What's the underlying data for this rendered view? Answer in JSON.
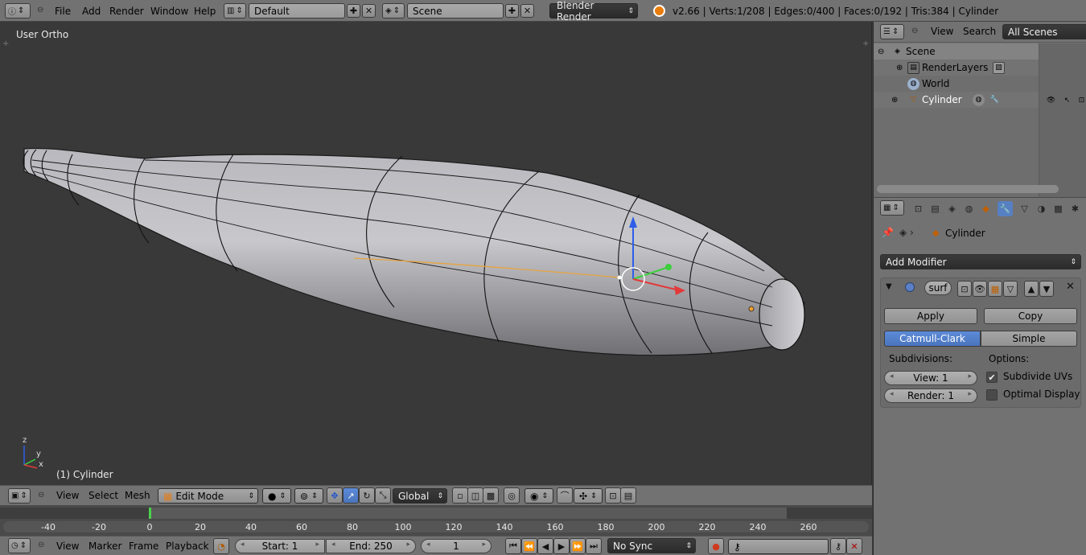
{
  "info_header": {
    "menus": [
      "File",
      "Add",
      "Render",
      "Window",
      "Help"
    ],
    "screen_layout": "Default",
    "scene": "Scene",
    "render_engine": "Blender Render",
    "stats": "v2.66 | Verts:1/208 | Edges:0/400 | Faces:0/192 | Tris:384 | Cylinder"
  },
  "viewport": {
    "view_name": "User Ortho",
    "object_label": "(1) Cylinder",
    "axis_labels": {
      "x": "x",
      "y": "y",
      "z": "z"
    }
  },
  "view3d_header": {
    "menus": [
      "View",
      "Select",
      "Mesh"
    ],
    "mode": "Edit Mode",
    "orientation": "Global"
  },
  "timeline": {
    "frame_ticks": [
      "-40",
      "-20",
      "0",
      "20",
      "40",
      "60",
      "80",
      "100",
      "120",
      "140",
      "160",
      "180",
      "200",
      "220",
      "240",
      "260"
    ],
    "current_frame": 1,
    "menus": [
      "View",
      "Marker",
      "Frame",
      "Playback"
    ],
    "start": "Start: 1",
    "end": "End: 250",
    "frame": "1",
    "sync": "No Sync"
  },
  "outliner": {
    "menus": [
      "View",
      "Search"
    ],
    "filter": "All Scenes",
    "tree": [
      {
        "label": "Scene",
        "level": 0
      },
      {
        "label": "RenderLayers",
        "level": 1
      },
      {
        "label": "World",
        "level": 1
      },
      {
        "label": "Cylinder",
        "level": 1
      }
    ]
  },
  "properties": {
    "object_name": "Cylinder",
    "add_modifier": "Add Modifier",
    "modifier_name": "surf",
    "apply": "Apply",
    "copy": "Copy",
    "subdiv_types": [
      "Catmull-Clark",
      "Simple"
    ],
    "active_subdiv_type": "Catmull-Clark",
    "subdivisions_label": "Subdivisions:",
    "options_label": "Options:",
    "view_levels": "View: 1",
    "render_levels": "Render: 1",
    "subdivide_uvs": "Subdivide UVs",
    "subdivide_uvs_checked": true,
    "optimal_display": "Optimal Display",
    "optimal_display_checked": false
  },
  "colors": {
    "active_tab": "#5680c2",
    "timeline_cursor": "#4bd14b",
    "edge_selected": "#e8a33c",
    "axis_x": "#e23a3a",
    "axis_y": "#3ccf3c",
    "axis_z": "#2e5ee8"
  }
}
